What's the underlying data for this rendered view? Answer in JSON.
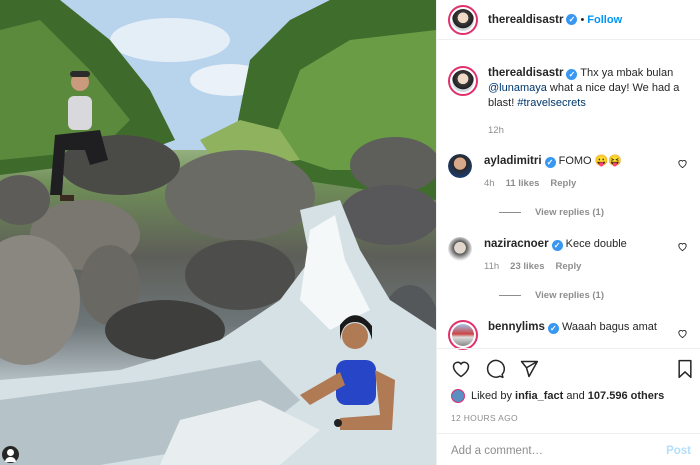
{
  "post": {
    "author": "therealdisastr",
    "follow_label": "Follow",
    "separator": "•",
    "caption": {
      "text_before": "Thx ya mbak bulan ",
      "mention": "@lunamaya",
      "text_middle": " what a nice day! We had a blast! ",
      "hashtag": "#travelsecrets",
      "time": "12h"
    }
  },
  "comments": [
    {
      "user": "ayladimitri",
      "verified": true,
      "text": "FOMO 😛😝",
      "time": "4h",
      "likes": "11 likes",
      "reply": "Reply",
      "view_replies": "View replies (1)"
    },
    {
      "user": "naziracnoer",
      "verified": true,
      "text": "Kece double",
      "time": "11h",
      "likes": "23 likes",
      "reply": "Reply",
      "view_replies": "View replies (1)"
    },
    {
      "user": "bennylims",
      "verified": true,
      "text": "Waaah bagus amat"
    }
  ],
  "actions": {
    "liked_prefix": "Liked by ",
    "liked_user": "infia_fact",
    "liked_and": " and ",
    "liked_count": "107.596 others",
    "time_ago": "12 HOURS AGO"
  },
  "add_comment": {
    "placeholder": "Add a comment…",
    "post_label": "Post"
  },
  "colors": {
    "link": "#00376b",
    "follow": "#0095f6",
    "verified": "#3897f0",
    "story_ring": "#e1306c",
    "muted": "#8e8e8e"
  },
  "icons": [
    "heart-icon",
    "comment-icon",
    "share-icon",
    "bookmark-icon",
    "verified-badge-icon",
    "user-tag-icon"
  ]
}
